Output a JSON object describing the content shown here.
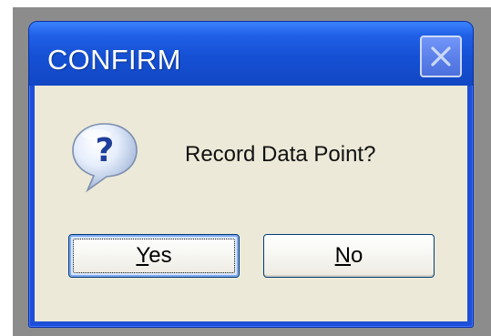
{
  "dialog": {
    "title": "CONFIRM",
    "message": "Record Data Point?",
    "icon": "question-icon",
    "close_icon": "close-icon"
  },
  "buttons": {
    "yes": {
      "mnemonic": "Y",
      "rest": "es"
    },
    "no": {
      "mnemonic": "N",
      "rest": "o"
    }
  },
  "colors": {
    "titlebar": "#1550d4",
    "client": "#ece9d8",
    "backdrop": "#8c8c8c"
  }
}
